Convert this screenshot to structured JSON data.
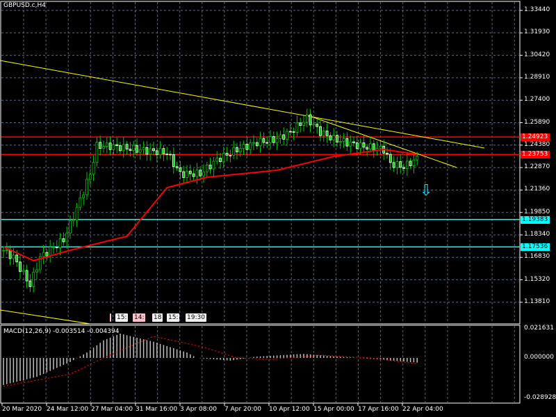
{
  "symbol_title": "GBPUSD.c,H4",
  "macd_label": "MACD(12,26,9) -0.003514 -0.004394",
  "colors": {
    "bg": "#000000",
    "grid": "#5c6a82",
    "bull": "#00cc00",
    "ma": "#ff0000",
    "trend": "#ffff00",
    "level_red": "#ff0000",
    "level_cyan": "#00ffff",
    "hist": "#c0c0c0"
  },
  "price_axis": [
    "1.33440",
    "1.31930",
    "1.30420",
    "1.28910",
    "1.27400",
    "1.25890",
    "1.24380",
    "1.22870",
    "1.21360",
    "1.19850",
    "1.18340",
    "1.16830",
    "1.15320",
    "1.13810"
  ],
  "macd_axis": [
    "0.021631",
    "0.000000",
    "-0.028928"
  ],
  "time_axis": [
    "20 Mar 2020",
    "24 Mar 12:00",
    "27 Mar 04:00",
    "31 Mar 16:00",
    "3 Apr 08:00",
    "7 Apr 20:00",
    "10 Apr 12:00",
    "15 Apr 00:00",
    "17 Apr 16:00",
    "22 Apr 04:00"
  ],
  "levels": [
    {
      "price": "1.24923",
      "color": "red"
    },
    {
      "price": "1.23753",
      "color": "red"
    },
    {
      "price": "1.19383",
      "color": "cyan"
    },
    {
      "price": "1.17536",
      "color": "cyan"
    }
  ],
  "trade_labels": [
    "15:",
    "14:",
    "18",
    "15:",
    "19:30"
  ],
  "chart_data": {
    "type": "candlestick",
    "title": "GBPUSD.c,H4",
    "bars": 125,
    "close_keypoints": [
      [
        0,
        1.1731
      ],
      [
        3,
        1.1684
      ],
      [
        8,
        1.1497
      ],
      [
        11,
        1.1684
      ],
      [
        18,
        1.1801
      ],
      [
        22,
        1.2012
      ],
      [
        26,
        1.2245
      ],
      [
        28,
        1.2432
      ],
      [
        32,
        1.2432
      ],
      [
        40,
        1.2409
      ],
      [
        49,
        1.2386
      ],
      [
        53,
        1.2245
      ],
      [
        59,
        1.2245
      ],
      [
        64,
        1.2339
      ],
      [
        70,
        1.2409
      ],
      [
        76,
        1.2456
      ],
      [
        82,
        1.2479
      ],
      [
        86,
        1.2526
      ],
      [
        91,
        1.2619
      ],
      [
        95,
        1.2526
      ],
      [
        99,
        1.2479
      ],
      [
        107,
        1.2432
      ],
      [
        114,
        1.2409
      ],
      [
        116,
        1.2315
      ],
      [
        120,
        1.2292
      ],
      [
        124,
        1.2348
      ]
    ],
    "ma_keypoints": [
      [
        0,
        1.1754
      ],
      [
        9,
        1.1661
      ],
      [
        20,
        1.1731
      ],
      [
        37,
        1.1825
      ],
      [
        49,
        1.2152
      ],
      [
        61,
        1.2222
      ],
      [
        82,
        1.2269
      ],
      [
        99,
        1.2362
      ],
      [
        114,
        1.2409
      ],
      [
        124,
        1.2376
      ]
    ],
    "macd_hist_keypoints": [
      [
        0,
        -0.02
      ],
      [
        10,
        -0.014
      ],
      [
        20,
        -0.003
      ],
      [
        25,
        0.004
      ],
      [
        30,
        0.013
      ],
      [
        35,
        0.018
      ],
      [
        45,
        0.012
      ],
      [
        55,
        0.004
      ],
      [
        58,
        0.0
      ],
      [
        68,
        -0.002
      ],
      [
        76,
        0.001
      ],
      [
        90,
        0.003
      ],
      [
        100,
        0.001
      ],
      [
        112,
        -0.001
      ],
      [
        124,
        -0.0035
      ]
    ],
    "macd_signal_keypoints": [
      [
        0,
        -0.021
      ],
      [
        20,
        -0.012
      ],
      [
        30,
        0.0
      ],
      [
        45,
        0.016
      ],
      [
        60,
        0.008
      ],
      [
        70,
        0.0
      ],
      [
        80,
        -0.001
      ],
      [
        95,
        0.002
      ],
      [
        110,
        0.0
      ],
      [
        124,
        -0.0044
      ]
    ],
    "price_range": [
      1.1281,
      1.3419
    ],
    "macd_range": [
      -0.028928,
      0.021631
    ]
  }
}
